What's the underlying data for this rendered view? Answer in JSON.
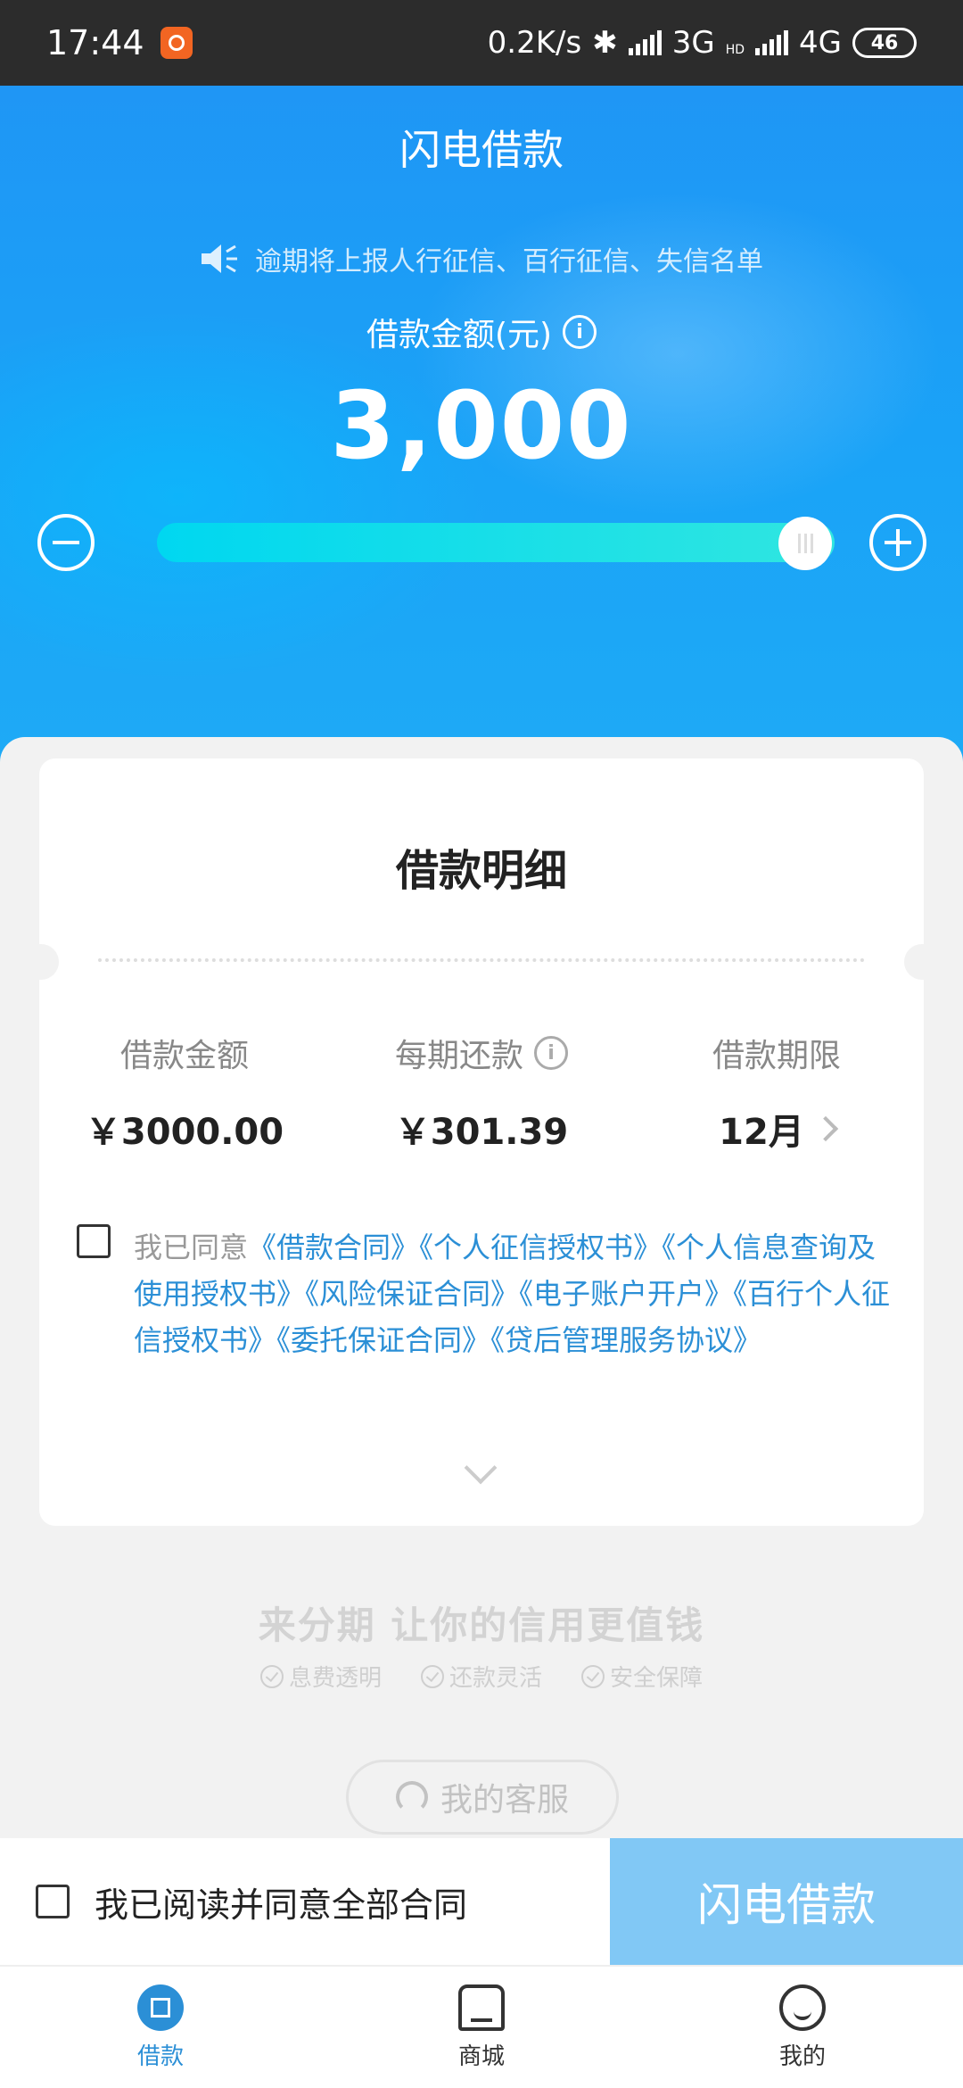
{
  "status_bar": {
    "time": "17:44",
    "network_speed": "0.2K/s",
    "net1": "3G",
    "hd": "HD",
    "net2": "4G",
    "battery": "46"
  },
  "header": {
    "title": "闪电借款",
    "notice": "逾期将上报人行征信、百行征信、失信名单",
    "amount_label": "借款金额(元)",
    "amount_value": "3,000",
    "slider": {
      "min_icon": "minus-icon",
      "max_icon": "plus-icon",
      "level": 1.0
    }
  },
  "details": {
    "title": "借款明细",
    "columns": [
      {
        "label": "借款金额",
        "value": "￥3000.00"
      },
      {
        "label": "每期还款",
        "value": "￥301.39"
      },
      {
        "label": "借款期限",
        "value": "12月"
      }
    ],
    "agreement_prefix": "我已同意",
    "agreement_links": "《借款合同》《个人征信授权书》《个人信息查询及使用授权书》《风险保证合同》《电子账户开户》《百行个人征信授权书》《委托保证合同》《贷后管理服务协议》"
  },
  "promo": {
    "slogan": "来分期 让你的信用更值钱",
    "features": [
      "息费透明",
      "还款灵活",
      "安全保障"
    ]
  },
  "service_button": "我的客服",
  "action_bar": {
    "agree_all": "我已阅读并同意全部合同",
    "submit": "闪电借款"
  },
  "tab_bar": [
    {
      "label": "借款",
      "icon": "loan-icon",
      "active": true
    },
    {
      "label": "商城",
      "icon": "shop-icon",
      "active": false
    },
    {
      "label": "我的",
      "icon": "profile-icon",
      "active": false
    }
  ],
  "colors": {
    "brand_blue": "#1f96f5",
    "link_blue": "#2b8fd6",
    "submit_disabled": "#81c8f5",
    "app_badge": "#f26522"
  }
}
